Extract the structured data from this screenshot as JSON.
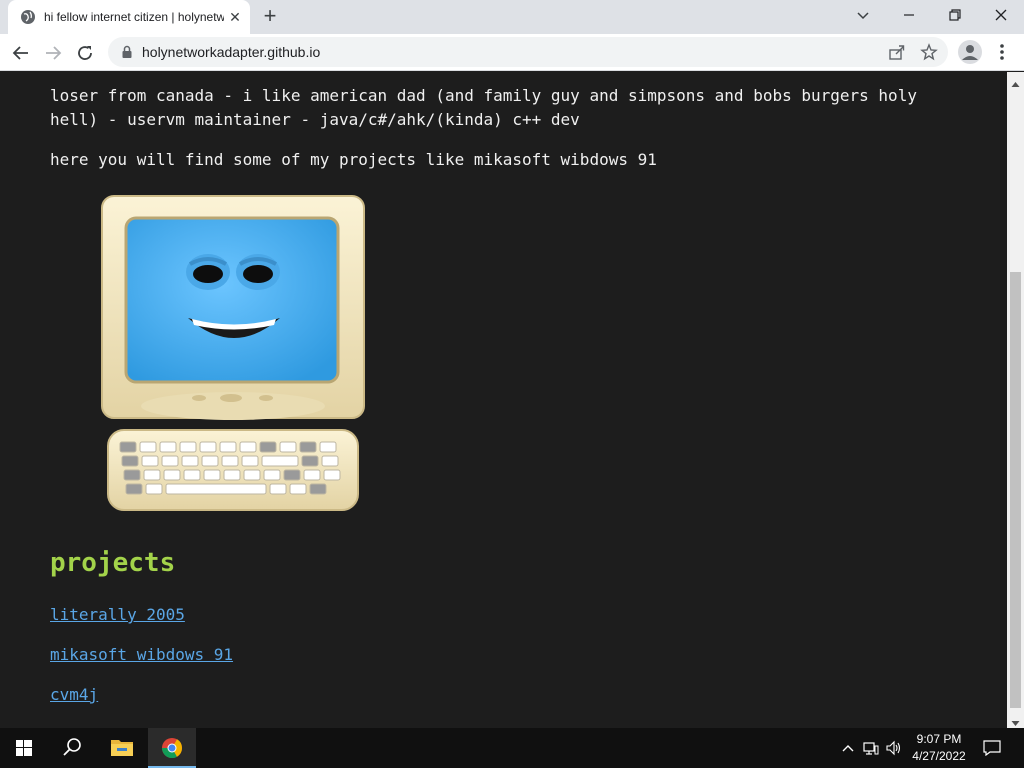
{
  "browser": {
    "tab_title": "hi fellow internet citizen | holynetworkadapter",
    "close_tab_glyph": "✕",
    "new_tab_glyph": "+",
    "url": "holynetworkadapter.github.io",
    "icons": [
      "globe-icon",
      "back-arrow-icon",
      "forward-arrow-icon",
      "reload-icon",
      "lock-icon",
      "share-icon",
      "star-icon",
      "profile-icon",
      "kebab-menu-icon",
      "minimize-icon",
      "restore-icon",
      "close-icon",
      "tab-search-icon"
    ]
  },
  "page": {
    "intro": "loser from canada - i like american dad (and family guy and simpsons and bobs burgers holy hell) - uservm maintainer - java/c#/ahk/(kinda) c++ dev",
    "subtitle": "here you will find some of my projects like mikasoft wibdows 91",
    "image": "smiling-computer-mascot",
    "projects_heading": "projects",
    "projects": [
      {
        "label": "literally 2005"
      },
      {
        "label": "mikasoft wibdows 91"
      },
      {
        "label": "cvm4j"
      }
    ],
    "colors": {
      "background": "#1d1d1d",
      "text": "#f0f0f0",
      "heading": "#a3d34a",
      "link": "#5aa6e6"
    }
  },
  "taskbar": {
    "clock_time": "9:07 PM",
    "clock_date": "4/27/2022",
    "icons": [
      "windows-start-icon",
      "search-icon",
      "file-explorer-icon",
      "chrome-icon",
      "chevron-up-icon",
      "network-icon",
      "volume-icon",
      "notification-icon"
    ]
  }
}
